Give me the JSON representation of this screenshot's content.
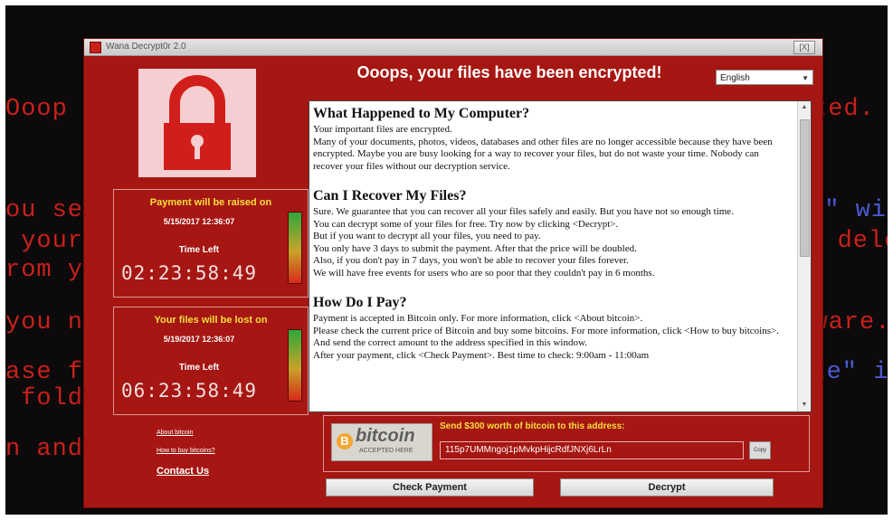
{
  "window": {
    "title": "Wana Decrypt0r 2.0",
    "headline": "Ooops, your files have been encrypted!",
    "language": "English",
    "close_symbol": "[X]"
  },
  "background_terminal": [
    "Ooop",
    "ted.",
    "ou see",
    "r\" wi",
    " your",
    "ou dele",
    "rom yo",
    "you nee",
    "ftware.",
    "ase fin",
    ".exe\" i",
    " folder",
    "n and fo"
  ],
  "payment_raise": {
    "heading": "Payment will be raised on",
    "date": "5/15/2017 12:36:07",
    "label": "Time Left",
    "countdown": "02:23:58:49"
  },
  "files_lost": {
    "heading": "Your files will be lost on",
    "date": "5/19/2017 12:36:07",
    "label": "Time Left",
    "countdown": "06:23:58:49"
  },
  "links": {
    "about_bitcoin": "About bitcoin",
    "how_to_buy": "How to buy bitcoins?",
    "contact": "Contact Us"
  },
  "message": {
    "h1": "What Happened to My Computer?",
    "p1": "Your important files are encrypted.",
    "p2": "Many of your documents, photos, videos, databases and other files are no longer accessible because they have been encrypted. Maybe you are busy looking for a way to recover your files, but do not waste your time. Nobody can recover your files without our decryption service.",
    "h2": "Can I Recover My Files?",
    "p3": "Sure. We guarantee that you can recover all your files safely and easily. But you have not so enough time.",
    "p4": "You can decrypt some of your files for free. Try now by clicking <Decrypt>.",
    "p5": "But if you want to decrypt all your files, you need to pay.",
    "p6": "You only have 3 days to submit the payment. After that the price will be doubled.",
    "p7": "Also, if you don't pay in 7 days, you won't be able to recover your files forever.",
    "p8": "We will have free events for users who are so poor that they couldn't pay in 6 months.",
    "h3": "How Do I Pay?",
    "p9": "Payment is accepted in Bitcoin only. For more information, click <About bitcoin>.",
    "p10": "Please check the current price of Bitcoin and buy some bitcoins. For more information, click <How to buy bitcoins>.",
    "p11": "And send the correct amount to the address specified in this window.",
    "p12": "After your payment, click <Check Payment>. Best time to check: 9:00am - 11:00am"
  },
  "bitcoin": {
    "logo_symbol": "B",
    "logo_word": "bitcoin",
    "logo_sub": "ACCEPTED HERE",
    "send_label": "Send $300 worth of bitcoin to this address:",
    "address": "115p7UMMngoj1pMvkpHijcRdfJNXj6LrLn",
    "copy_label": "Copy"
  },
  "buttons": {
    "check_payment": "Check Payment",
    "decrypt": "Decrypt"
  },
  "colors": {
    "window_red": "#a61612",
    "header_yellow": "#f6df3d",
    "terminal_red": "#c8211a"
  },
  "icons": [
    "padlock-icon",
    "bitcoin-icon",
    "dropdown-arrow-icon",
    "scroll-up-icon",
    "scroll-down-icon",
    "window-icon"
  ]
}
